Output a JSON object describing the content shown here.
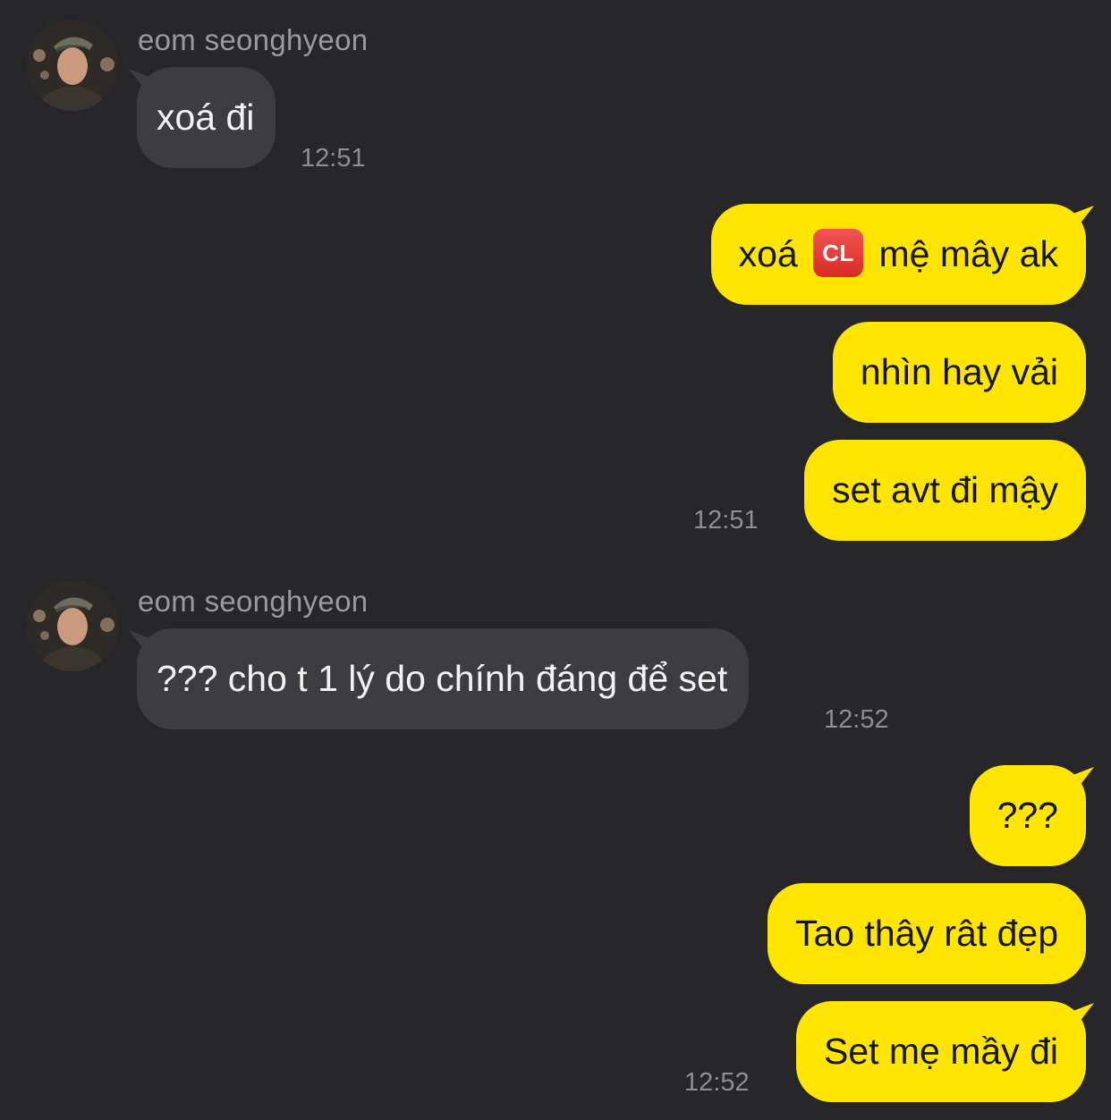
{
  "colors": {
    "background": "#27272a",
    "incoming_bubble": "#3d3d40",
    "outgoing_bubble": "#ffe500",
    "timestamp": "#8e8e92"
  },
  "groups": [
    {
      "sender": "eom seonghyeon",
      "messages": [
        "xoá đi"
      ],
      "time": "12:51"
    },
    {
      "messages": [
        {
          "before": "xoá",
          "badge": "CL",
          "after": "mệ mây ak"
        },
        "nhìn hay vải",
        "set avt đi mậy"
      ],
      "time": "12:51"
    },
    {
      "sender": "eom seonghyeon",
      "messages": [
        "??? cho t 1 lý do chính đáng để set"
      ],
      "time": "12:52"
    },
    {
      "messages": [
        "???",
        "Tao thây rât đẹp",
        "Set mẹ mầy đi"
      ],
      "time": "12:52"
    }
  ]
}
